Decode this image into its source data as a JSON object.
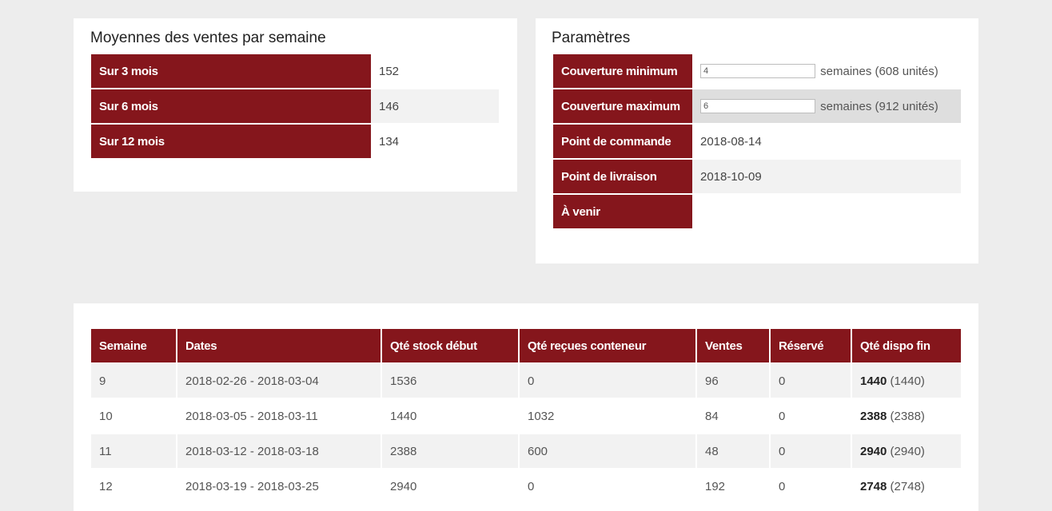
{
  "averages": {
    "title": "Moyennes des ventes par semaine",
    "rows": [
      {
        "label": "Sur 3 mois",
        "value": "152"
      },
      {
        "label": "Sur 6 mois",
        "value": "146"
      },
      {
        "label": "Sur 12 mois",
        "value": "134"
      }
    ]
  },
  "parameters": {
    "title": "Paramètres",
    "coverage_min": {
      "label": "Couverture minimum",
      "input_value": "4",
      "suffix": "semaines (608 unités)"
    },
    "coverage_max": {
      "label": "Couverture maximum",
      "input_value": "6",
      "suffix": "semaines (912 unités)"
    },
    "order_point": {
      "label": "Point de commande",
      "value": "2018-08-14"
    },
    "delivery_point": {
      "label": "Point de livraison",
      "value": "2018-10-09"
    },
    "upcoming": {
      "label": "À venir",
      "value": ""
    }
  },
  "weeks_table": {
    "headers": [
      "Semaine",
      "Dates",
      "Qté stock début",
      "Qté reçues conteneur",
      "Ventes",
      "Réservé",
      "Qté dispo fin"
    ],
    "rows": [
      {
        "week": "9",
        "dates": "2018-02-26 - 2018-03-04",
        "stock_start": "1536",
        "received": "0",
        "sales": "96",
        "reserved": "0",
        "available_bold": "1440",
        "available_paren": "(1440)"
      },
      {
        "week": "10",
        "dates": "2018-03-05 - 2018-03-11",
        "stock_start": "1440",
        "received": "1032",
        "sales": "84",
        "reserved": "0",
        "available_bold": "2388",
        "available_paren": "(2388)"
      },
      {
        "week": "11",
        "dates": "2018-03-12 - 2018-03-18",
        "stock_start": "2388",
        "received": "600",
        "sales": "48",
        "reserved": "0",
        "available_bold": "2940",
        "available_paren": "(2940)"
      },
      {
        "week": "12",
        "dates": "2018-03-19 - 2018-03-25",
        "stock_start": "2940",
        "received": "0",
        "sales": "192",
        "reserved": "0",
        "available_bold": "2748",
        "available_paren": "(2748)"
      }
    ]
  },
  "colors": {
    "header_bg": "#85161c",
    "page_bg": "#ededed",
    "row_alt": "#f2f2f2"
  }
}
